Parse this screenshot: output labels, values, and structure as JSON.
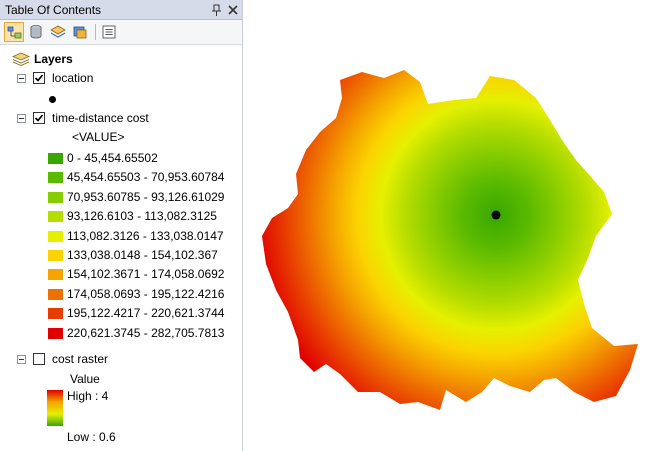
{
  "panel": {
    "title": "Table Of Contents",
    "pin_symbol": "ᵦ",
    "close_symbol": "×"
  },
  "toolbar": {
    "buttons": [
      {
        "icon": "list-by-drawing-order-icon",
        "active": true
      },
      {
        "icon": "list-by-source-icon",
        "active": false
      },
      {
        "icon": "list-by-visibility-icon",
        "active": false
      },
      {
        "icon": "list-by-selection-icon",
        "active": false
      },
      {
        "icon": "options-icon",
        "active": false
      }
    ]
  },
  "layers": {
    "group_label": "Layers",
    "location": {
      "label": "location",
      "checked": true
    },
    "time_distance_cost": {
      "label": "time-distance cost",
      "checked": true,
      "field_heading": "<VALUE>",
      "classes": [
        {
          "label": "0 - 45,454.65502",
          "color": "#38a800"
        },
        {
          "label": "45,454.65503 - 70,953.60784",
          "color": "#5bba00"
        },
        {
          "label": "70,953.60785 - 93,126.61029",
          "color": "#87cc00"
        },
        {
          "label": "93,126.6103 - 113,082.3125",
          "color": "#b6dd00"
        },
        {
          "label": "113,082.3126 - 133,038.0147",
          "color": "#e5f000"
        },
        {
          "label": "133,038.0148 - 154,102.367",
          "color": "#fbd300"
        },
        {
          "label": "154,102.3671 - 174,058.0692",
          "color": "#f5a400"
        },
        {
          "label": "174,058.0693 - 195,122.4216",
          "color": "#ee7000"
        },
        {
          "label": "195,122.4217 - 220,621.3744",
          "color": "#e83c00"
        },
        {
          "label": "220,621.3745 - 282,705.7813",
          "color": "#e00000"
        }
      ]
    },
    "cost_raster": {
      "label": "cost raster",
      "checked": false,
      "value_heading": "Value",
      "high_label": "High : 4",
      "low_label": "Low : 0.6",
      "ramp_colors": [
        "#e00000",
        "#f5a400",
        "#e5f000",
        "#38a800"
      ]
    }
  },
  "colors": {
    "panel_title_bg": "#d6dbe9",
    "map_background": "#ffffff",
    "location_point": "#000000"
  }
}
